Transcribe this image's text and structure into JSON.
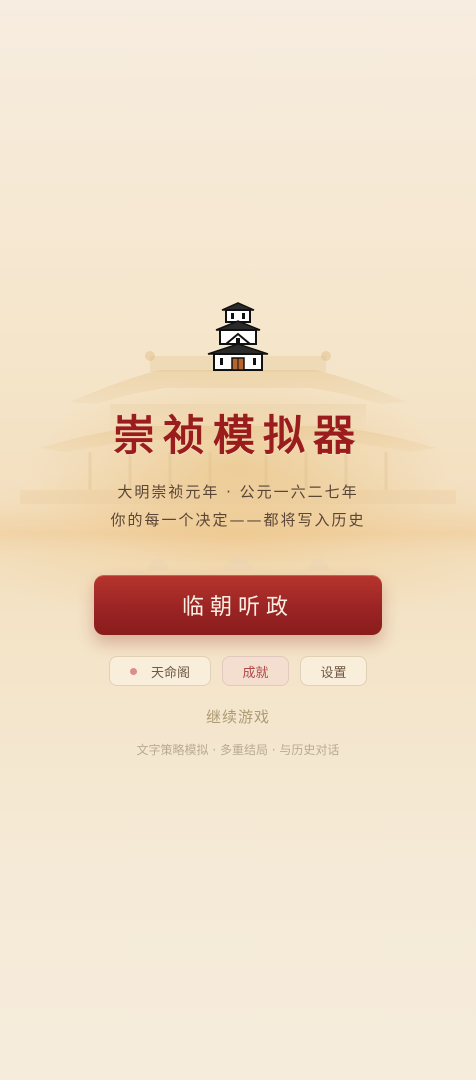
{
  "title": "崇祯模拟器",
  "subtitle_line1": "大明崇祯元年 · 公元一六二七年",
  "subtitle_line2": "你的每一个决定——都将写入历史",
  "start_button": "临朝听政",
  "menu": {
    "fate_pavilion": "天命阁",
    "achievements": "成就",
    "settings": "设置"
  },
  "continue_game": "继续游戏",
  "tagline": "文字策略模拟 · 多重结局 · 与历史对话",
  "colors": {
    "title_red": "#9b1c1c",
    "button_red": "#9b2424",
    "background_cream": "#f4e8d2",
    "muted_gold": "#ae9a76"
  },
  "icons": {
    "hero": "japanese-castle-icon",
    "fate_marker": "dot-icon"
  }
}
